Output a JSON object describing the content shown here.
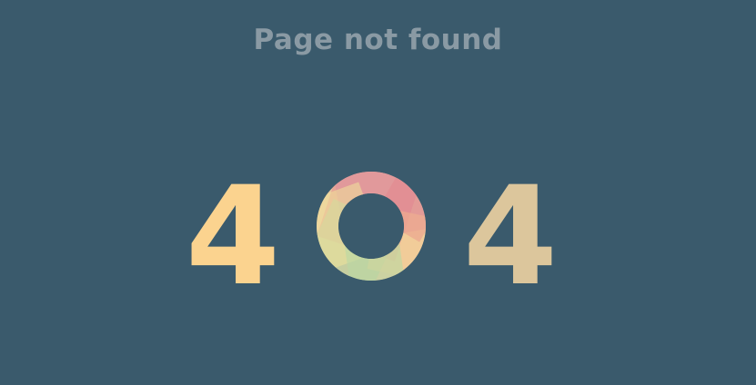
{
  "page": {
    "title": "Page not found",
    "code": {
      "first_digit": "4",
      "middle_digit": "0",
      "last_digit": "4"
    }
  },
  "colors": {
    "background": "#3a5a6c",
    "title": "#8a9aa4",
    "digit_left": "#fbd38f",
    "digit_right": "#dcc69c"
  }
}
